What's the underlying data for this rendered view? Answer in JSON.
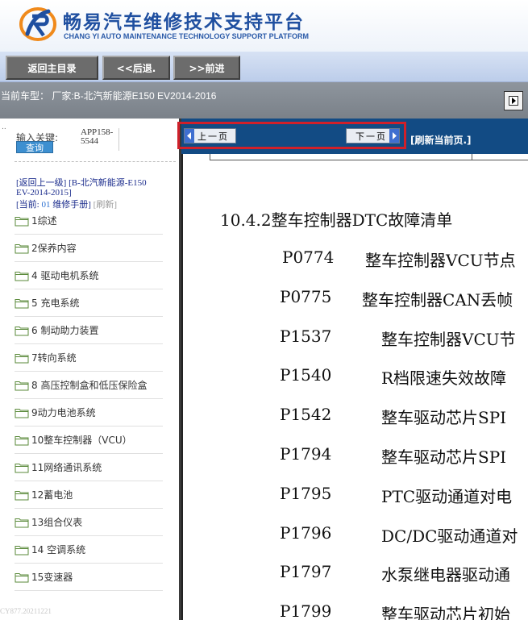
{
  "header": {
    "title": "畅易汽车维修技术支持平台",
    "subtitle": "CHANG YI AUTO MAINTENANCE TECHNOLOGY SUPPORT PLATFORM"
  },
  "nav": {
    "home": "返回主目录",
    "back": "<<后退.",
    "forward": ">>前进"
  },
  "vehicle_bar": {
    "text": "当前车型： 厂家:B-北汽新能源E150 EV2014-2016"
  },
  "sidebar": {
    "dot": "..",
    "search_label": "输入关键:",
    "search_button": "查询",
    "search_value": "APP158-5544",
    "crumb_back": "[返回上一级]",
    "crumb_model": "[B-北汽新能源-E150 EV-2014-2015]",
    "current_prefix": "[当前:",
    "current_code": "01",
    "current_name": "维修手册]",
    "refresh": "[刷新]",
    "menu": [
      "1综述",
      "2保养内容",
      "4 驱动电机系统",
      "5 充电系统",
      "6 制动助力装置",
      "7转向系统",
      "8 高压控制盒和低压保险盒",
      "9动力电池系统",
      "10整车控制器（VCU）",
      "11网络通讯系统",
      "12蓄电池",
      "13组合仪表",
      "14 空调系统",
      "15变速器"
    ],
    "watermark": "CY877.20211221"
  },
  "content": {
    "prev_page": "上一页",
    "next_page": "下一页",
    "refresh_page": "[刷新当前页.]",
    "heading": "10.4.2整车控制器DTC故障清单",
    "dtc": [
      {
        "code": "P0774",
        "desc": "整车控制器VCU节点"
      },
      {
        "code": "P0775",
        "desc": "整车控制器CAN丢帧"
      },
      {
        "code": "P1537",
        "desc": "整车控制器VCU节"
      },
      {
        "code": "P1540",
        "desc": "R档限速失效故障"
      },
      {
        "code": "P1542",
        "desc": "整车驱动芯片SPI"
      },
      {
        "code": "P1794",
        "desc": "整车驱动芯片SPI"
      },
      {
        "code": "P1795",
        "desc": "PTC驱动通道对电"
      },
      {
        "code": "P1796",
        "desc": "DC/DC驱动通道对"
      },
      {
        "code": "P1797",
        "desc": "水泵继电器驱动通"
      },
      {
        "code": "P1799",
        "desc": "整车驱动芯片初始"
      }
    ]
  },
  "colors": {
    "brand_blue": "#1f4fa0",
    "toolbar_blue": "#124b84",
    "highlight_red": "#d0202a",
    "nav_button_gray": "#6c6c6c",
    "vehicle_bar_gray": "#868d95"
  }
}
